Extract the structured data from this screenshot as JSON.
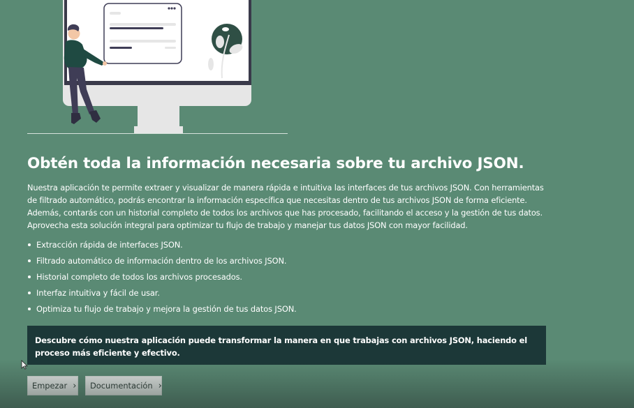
{
  "hero": {
    "title": "Obtén toda la información necesaria sobre tu archivo JSON.",
    "description": "Nuestra aplicación te permite extraer y visualizar de manera rápida e intuitiva las interfaces de tus archivos JSON. Con herramientas de filtrado automático, podrás encontrar la información específica que necesitas dentro de tus archivos JSON de forma eficiente. Además, contarás con un historial completo de todos los archivos que has procesado, facilitando el acceso y la gestión de tus datos. Aprovecha esta solución integral para optimizar tu flujo de trabajo y manejar tus datos JSON con mayor facilidad."
  },
  "features": [
    "Extracción rápida de interfaces JSON.",
    "Filtrado automático de información dentro de los archivos JSON.",
    "Historial completo de todos los archivos procesados.",
    "Interfaz intuitiva y fácil de usar.",
    "Optimiza tu flujo de trabajo y mejora la gestión de tus datos JSON."
  ],
  "callout": {
    "text": "Descubre cómo nuestra aplicación puede transformar la manera en que trabajas con archivos JSON, haciendo el proceso más eficiente y efectivo."
  },
  "buttons": {
    "start_label": "Empezar",
    "docs_label": "Documentación",
    "chevron": "›"
  },
  "icons": {
    "illustration": "person-at-monitor-illustration",
    "chevron": "chevron-right-icon",
    "cursor": "mouse-pointer-icon"
  },
  "colors": {
    "background": "#5a8a74",
    "callout_bg": "#1c3838",
    "button_bg": "#e9ecea",
    "text": "#ffffff"
  }
}
